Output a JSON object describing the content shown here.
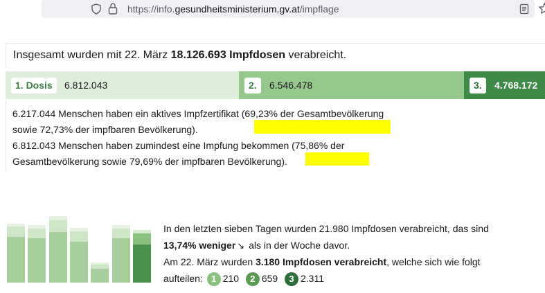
{
  "browser": {
    "url_prefix": "https://info.",
    "url_host": "gesundheitsministerium.gv.at",
    "url_path": "/impflage"
  },
  "summary": {
    "prefix": "Insgesamt wurden mit 22. März ",
    "total": "18.126.693 Impfdosen",
    "suffix": " verabreicht."
  },
  "doses": [
    {
      "label": "1. Dosis",
      "value": "6.812.043"
    },
    {
      "label": "2.",
      "value": "6.546.478"
    },
    {
      "label": "3.",
      "value": "4.768.172"
    }
  ],
  "info": {
    "line1": "6.217.044 Menschen haben ein aktives Impfzertifikat (69,23% der Gesamtbevölkerung",
    "line2": "sowie 72,73% der impfbaren Bevölkerung).",
    "line3": "6.812.043 Menschen haben zumindest eine Impfung bekommen (75,86% der",
    "line4": "Gesamtbevölkerung sowie 79,69% der impfbaren Bevölkerung)."
  },
  "weekly": {
    "line1": "In den letzten sieben Tagen wurden 21.980 Impfdosen verabreicht, das sind",
    "change": "13,74% weniger",
    "arrow": "↘",
    "line2_rest": " als in der Woche davor.",
    "line3_prefix": "Am 22. März wurden ",
    "line3_bold": "3.180 Impfdosen verabreicht",
    "line3_suffix": ", welche sich wie folgt",
    "line4_prefix": "aufteilen: ",
    "split": [
      {
        "num": "1",
        "value": "210"
      },
      {
        "num": "2",
        "value": "659"
      },
      {
        "num": "3",
        "value": "2.311"
      }
    ]
  },
  "weekly_chart": {
    "days": [
      {
        "d1": 0.05,
        "d2": 0.18,
        "d3": 0.77
      },
      {
        "d1": 0.06,
        "d2": 0.17,
        "d3": 0.77
      },
      {
        "d1": 0.06,
        "d2": 0.18,
        "d3": 0.76
      },
      {
        "d1": 0.06,
        "d2": 0.19,
        "d3": 0.75
      },
      {
        "d1": 0.1,
        "d2": 0.2,
        "d3": 0.7
      },
      {
        "d1": 0.06,
        "d2": 0.17,
        "d3": 0.77
      },
      {
        "d1": 0.07,
        "d2": 0.21,
        "d3": 0.72
      }
    ],
    "totals": [
      3560,
      3470,
      4000,
      3280,
      1200,
      3450,
      3180
    ],
    "max": 4000,
    "colors": {
      "past": [
        "#e6f1e2",
        "#cfe5c8",
        "#a8ce9e"
      ],
      "current": [
        "#d6ead0",
        "#8cc27f",
        "#4a8f4c"
      ]
    }
  }
}
